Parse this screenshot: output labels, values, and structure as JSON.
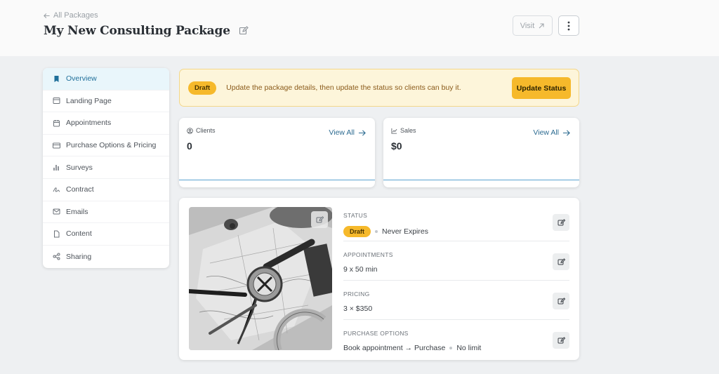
{
  "header": {
    "back_label": "All Packages",
    "title": "My New Consulting Package",
    "visit_label": "Visit"
  },
  "sidebar": {
    "items": [
      {
        "label": "Overview",
        "icon": "bookmark-icon",
        "active": true
      },
      {
        "label": "Landing Page",
        "icon": "browser-icon"
      },
      {
        "label": "Appointments",
        "icon": "calendar-icon"
      },
      {
        "label": "Purchase Options & Pricing",
        "icon": "credit-card-icon"
      },
      {
        "label": "Surveys",
        "icon": "bar-chart-icon"
      },
      {
        "label": "Contract",
        "icon": "signature-icon"
      },
      {
        "label": "Emails",
        "icon": "envelope-icon"
      },
      {
        "label": "Content",
        "icon": "file-icon"
      },
      {
        "label": "Sharing",
        "icon": "share-icon"
      }
    ]
  },
  "banner": {
    "badge": "Draft",
    "text": "Update the package details, then update the status so clients can buy it.",
    "button": "Update Status"
  },
  "stats": {
    "clients": {
      "label": "Clients",
      "value": "0",
      "link": "View All"
    },
    "sales": {
      "label": "Sales",
      "value": "$0",
      "link": "View All"
    }
  },
  "details": {
    "status": {
      "label": "Status",
      "badge": "Draft",
      "value": "Never Expires"
    },
    "appointments": {
      "label": "Appointments",
      "value": "9 x 50 min"
    },
    "pricing": {
      "label": "Pricing",
      "value": "3 × $350"
    },
    "purchase_options": {
      "label": "Purchase Options",
      "value_a": "Book appointment → Purchase",
      "value_b": "No limit"
    }
  },
  "colors": {
    "accent": "#2c6b91",
    "draft": "#f6b92b",
    "banner_bg": "#fdf5da",
    "active_bg": "#e9f6fb"
  }
}
